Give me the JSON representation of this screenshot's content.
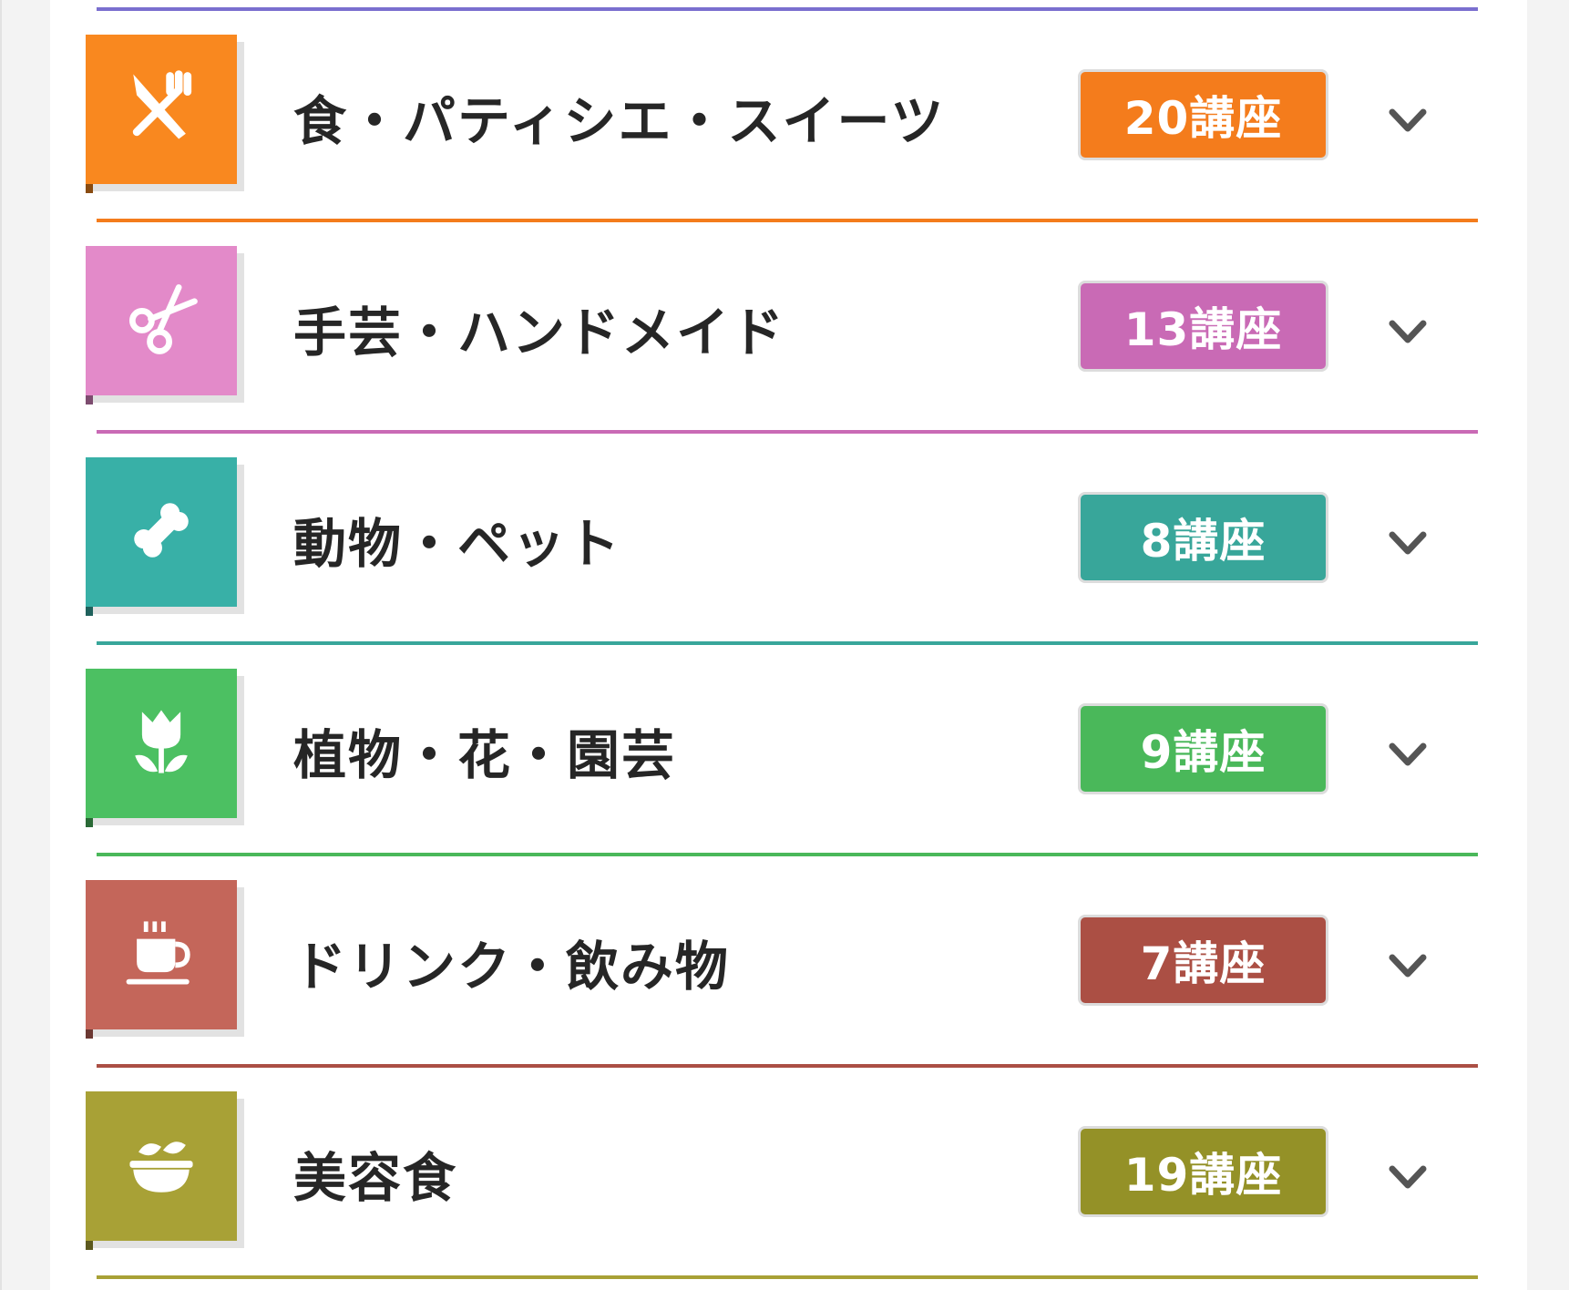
{
  "categories": [
    {
      "title": "食・パティシエ・スイーツ",
      "badge": "20講座",
      "icon": "fork-knife-icon",
      "color": "#f9881f",
      "badge_color": "#f47c1c"
    },
    {
      "title": "手芸・ハンドメイド",
      "badge": "13講座",
      "icon": "scissors-icon",
      "color": "#e38ac9",
      "badge_color": "#c96ab5"
    },
    {
      "title": "動物・ペット",
      "badge": "8講座",
      "icon": "bone-icon",
      "color": "#38b0a7",
      "badge_color": "#38a69a"
    },
    {
      "title": "植物・花・園芸",
      "badge": "9講座",
      "icon": "tulip-icon",
      "color": "#4cc062",
      "badge_color": "#4ab85a"
    },
    {
      "title": "ドリンク・飲み物",
      "badge": "7講座",
      "icon": "coffee-cup-icon",
      "color": "#c4665a",
      "badge_color": "#ab4f44"
    },
    {
      "title": "美容食",
      "badge": "19講座",
      "icon": "salad-bowl-icon",
      "color": "#a8a136",
      "badge_color": "#949127"
    }
  ]
}
